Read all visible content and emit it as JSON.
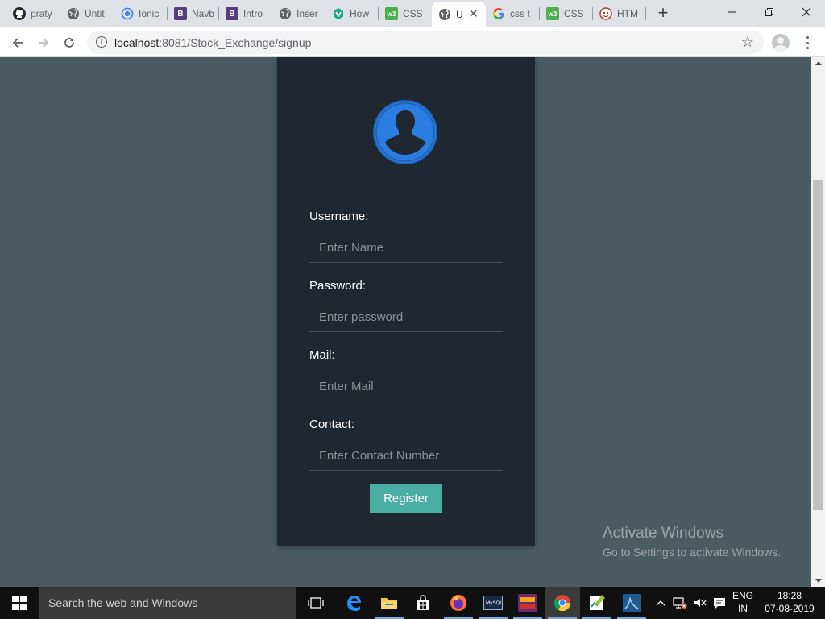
{
  "browser": {
    "tabs": [
      {
        "label": "praty",
        "icon": "github-icon"
      },
      {
        "label": "Untit",
        "icon": "globe-icon"
      },
      {
        "label": "Ionic",
        "icon": "ionic-icon"
      },
      {
        "label": "Navb",
        "icon": "bootstrap-icon"
      },
      {
        "label": "Intro",
        "icon": "bootstrap-icon"
      },
      {
        "label": "Inser",
        "icon": "globe-icon"
      },
      {
        "label": "How",
        "icon": "vue-icon"
      },
      {
        "label": "CSS",
        "icon": "w3schools-icon"
      },
      {
        "label": "U",
        "icon": "globe-icon",
        "active": true
      },
      {
        "label": "css t",
        "icon": "google-icon"
      },
      {
        "label": "CSS",
        "icon": "w3schools-icon"
      },
      {
        "label": "HTM",
        "icon": "html-icon"
      }
    ],
    "url_host": "localhost",
    "url_path": ":8081/Stock_Exchange/signup"
  },
  "signup": {
    "username_label": "Username:",
    "username_placeholder": "Enter Name",
    "password_label": "Password:",
    "password_placeholder": "Enter password",
    "mail_label": "Mail:",
    "mail_placeholder": "Enter Mail",
    "contact_label": "Contact:",
    "contact_placeholder": "Enter Contact Number",
    "register_label": "Register"
  },
  "watermark": {
    "title": "Activate Windows",
    "subtitle": "Go to Settings to activate Windows."
  },
  "taskbar": {
    "search_placeholder": "Search the web and Windows",
    "lang_top": "ENG",
    "lang_bottom": "IN",
    "time": "18:28",
    "date": "07-08-2019"
  },
  "colors": {
    "page_bg": "#4a5c62",
    "card_bg": "#1f2730",
    "avatar_blue": "#2a7de1",
    "button_teal": "#4aaea4"
  }
}
